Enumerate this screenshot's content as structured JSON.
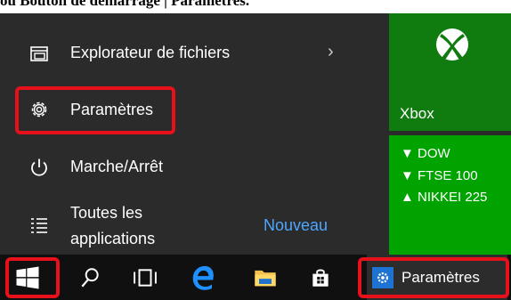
{
  "caption": "ou Bouton de démarrage | Paramètres.",
  "start_menu": {
    "items": [
      {
        "label": "Explorateur de fichiers",
        "icon": "file-explorer-icon"
      },
      {
        "label": "Paramètres",
        "icon": "gear-icon"
      },
      {
        "label": "Marche/Arrêt",
        "icon": "power-icon"
      },
      {
        "label_line1": "Toutes les",
        "label_line2": "applications",
        "badge": "Nouveau",
        "icon": "all-apps-icon"
      }
    ]
  },
  "tiles": {
    "xbox": {
      "label": "Xbox",
      "icon": "xbox-logo-icon"
    },
    "money": {
      "tickers": [
        "▼ DOW",
        "▼ FTSE 100",
        "▲ NIKKEI 225"
      ]
    }
  },
  "taskbar": {
    "settings_app_label": "Paramètres"
  },
  "colors": {
    "menu_bg": "#2b2b2b",
    "xbox_green": "#107c10",
    "money_green": "#00a300",
    "accent_blue": "#1e73d2",
    "highlight_red": "#e8101a"
  }
}
